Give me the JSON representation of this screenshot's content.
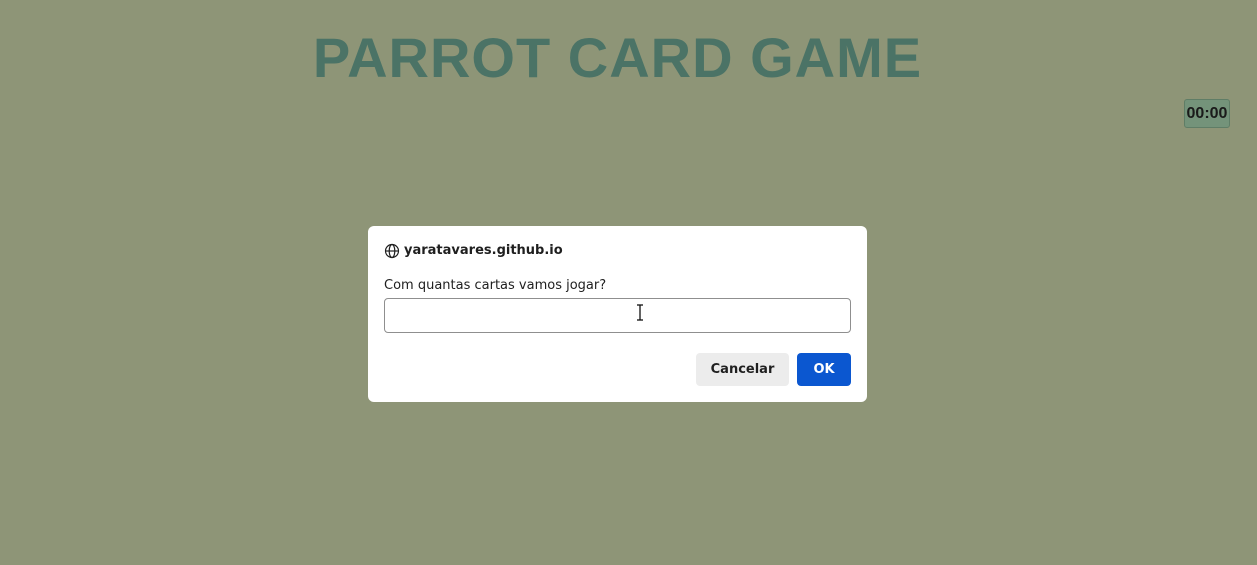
{
  "game": {
    "title": "PARROT CARD GAME",
    "timer": "00:00"
  },
  "dialog": {
    "origin": "yaratavares.github.io",
    "origin_icon": "globe-icon",
    "message": "Com quantas cartas vamos jogar?",
    "input_value": "",
    "cancel_label": "Cancelar",
    "ok_label": "OK"
  },
  "colors": {
    "background": "#8e9577",
    "title": "#4b7366",
    "timer_bg": "#74937a",
    "ok_button": "#0b57d0"
  }
}
